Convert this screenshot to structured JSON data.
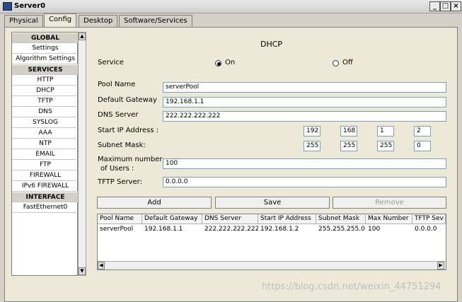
{
  "window": {
    "title": "Server0"
  },
  "tabs": [
    "Physical",
    "Config",
    "Desktop",
    "Software/Services"
  ],
  "nav": {
    "global_header": "GLOBAL",
    "global_items": [
      "Settings",
      "Algorithm Settings"
    ],
    "services_header": "SERVICES",
    "service_items": [
      "HTTP",
      "DHCP",
      "TFTP",
      "DNS",
      "SYSLOG",
      "AAA",
      "NTP",
      "EMAIL",
      "FTP",
      "FIREWALL",
      "IPv6 FIREWALL"
    ],
    "interface_header": "INTERFACE",
    "interface_items": [
      "FastEthernet0"
    ]
  },
  "dhcp": {
    "title": "DHCP",
    "service_label": "Service",
    "on_label": "On",
    "off_label": "Off",
    "service_on": true,
    "pool_name_label": "Pool Name",
    "pool_name": "serverPool",
    "gateway_label": "Default Gateway",
    "gateway": "192.168.1.1",
    "dns_label": "DNS Server",
    "dns": "222.222.222.222",
    "start_ip_label": "Start IP Address :",
    "start_ip": [
      "192",
      "168",
      "1",
      "2"
    ],
    "subnet_label": "Subnet Mask:",
    "subnet": [
      "255",
      "255",
      "255",
      "0"
    ],
    "max_users_label_1": "Maximum number",
    "max_users_label_2": "of Users :",
    "max_users": "100",
    "tftp_label": "TFTP Server:",
    "tftp": "0.0.0.0"
  },
  "buttons": {
    "add": "Add",
    "save": "Save",
    "remove": "Remove"
  },
  "table": {
    "headers": [
      "Pool Name",
      "Default Gateway",
      "DNS Server",
      "Start IP Address",
      "Subnet Mask",
      "Max Number",
      "TFTP Sev"
    ],
    "rows": [
      [
        "serverPool",
        "192.168.1.1",
        "222.222.222.222",
        "192.168.1.2",
        "255.255.255.0",
        "100",
        "0.0.0.0"
      ]
    ]
  },
  "watermark": "https://blog.csdn.net/weixin_44751294"
}
